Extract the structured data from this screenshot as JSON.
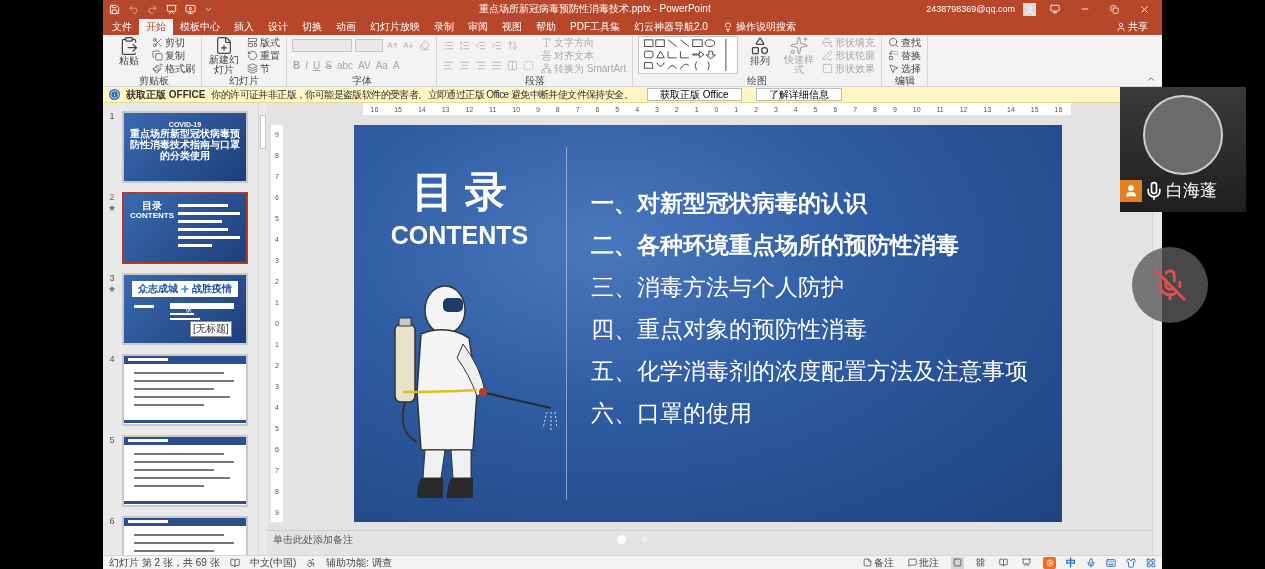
{
  "window": {
    "title": "重点场所新冠病毒预防性消毒技术.pptx  -  PowerPoint",
    "account": "2438798369@qq.com"
  },
  "tabs": [
    {
      "label": "文件",
      "selected": false
    },
    {
      "label": "开始",
      "selected": true
    },
    {
      "label": "模板中心",
      "selected": false
    },
    {
      "label": "插入",
      "selected": false
    },
    {
      "label": "设计",
      "selected": false
    },
    {
      "label": "切换",
      "selected": false
    },
    {
      "label": "动画",
      "selected": false
    },
    {
      "label": "幻灯片放映",
      "selected": false
    },
    {
      "label": "录制",
      "selected": false
    },
    {
      "label": "审阅",
      "selected": false
    },
    {
      "label": "视图",
      "selected": false
    },
    {
      "label": "帮助",
      "selected": false
    },
    {
      "label": "PDF工具集",
      "selected": false
    },
    {
      "label": "幻云神器导航2.0",
      "selected": false
    }
  ],
  "tell_me": "操作说明搜索",
  "share": "共享",
  "ribbon": [
    {
      "label": "剪贴板",
      "columns": [
        [
          {
            "kind": "large",
            "label": "粘贴",
            "disabled": false
          }
        ],
        [
          {
            "kind": "small",
            "label": "剪切",
            "disabled": false
          },
          {
            "kind": "small",
            "label": "复制",
            "disabled": false
          },
          {
            "kind": "small",
            "label": "格式刷",
            "disabled": false
          }
        ]
      ]
    },
    {
      "label": "幻灯片",
      "columns": [
        [
          {
            "kind": "large",
            "label": "新建幻灯片",
            "disabled": false
          }
        ],
        [
          {
            "kind": "small",
            "label": "版式",
            "disabled": false
          },
          {
            "kind": "small",
            "label": "重置",
            "disabled": false
          },
          {
            "kind": "small",
            "label": "节",
            "disabled": false
          }
        ]
      ]
    },
    {
      "label": "字体",
      "columns": [
        [
          {
            "kind": "toolrow",
            "tools": [
              {
                "kind": "field"
              },
              {
                "kind": "field"
              },
              {
                "kind": "icon"
              },
              {
                "kind": "icon"
              },
              {
                "kind": "icon"
              }
            ],
            "disabled": true
          },
          {
            "kind": "toolrow",
            "tools": [
              {
                "kind": "char",
                "label": "B"
              },
              {
                "kind": "char",
                "label": "I"
              },
              {
                "kind": "char",
                "label": "U"
              },
              {
                "kind": "char",
                "label": "S"
              },
              {
                "kind": "char",
                "label": "abc"
              },
              {
                "kind": "char",
                "label": "AV"
              },
              {
                "kind": "char",
                "label": "Aa"
              },
              {
                "kind": "char",
                "label": "A"
              }
            ],
            "disabled": true
          }
        ]
      ]
    },
    {
      "label": "段落",
      "columns": [
        [
          {
            "kind": "toolrow",
            "tools": [
              {
                "kind": "icon"
              },
              {
                "kind": "icon"
              },
              {
                "kind": "icon"
              },
              {
                "kind": "icon"
              },
              {
                "kind": "icon"
              }
            ],
            "disabled": true
          },
          {
            "kind": "toolrow",
            "tools": [
              {
                "kind": "icon"
              },
              {
                "kind": "icon"
              },
              {
                "kind": "icon"
              },
              {
                "kind": "icon"
              },
              {
                "kind": "icon"
              },
              {
                "kind": "icon"
              }
            ],
            "disabled": true
          }
        ],
        [
          {
            "kind": "small",
            "label": "文字方向",
            "disabled": true
          },
          {
            "kind": "small",
            "label": "对齐文本",
            "disabled": true
          },
          {
            "kind": "small",
            "label": "转换为 SmartArt",
            "disabled": true
          }
        ]
      ]
    },
    {
      "label": "绘图",
      "columns": [
        [
          {
            "kind": "gallery",
            "disabled": false
          }
        ],
        [
          {
            "kind": "large",
            "label": "排列",
            "disabled": false
          }
        ],
        [
          {
            "kind": "large",
            "label": "快速样式",
            "disabled": true
          }
        ],
        [
          {
            "kind": "small",
            "label": "形状填充",
            "disabled": true
          },
          {
            "kind": "small",
            "label": "形状轮廓",
            "disabled": true
          },
          {
            "kind": "small",
            "label": "形状效果",
            "disabled": true
          }
        ]
      ]
    },
    {
      "label": "编辑",
      "columns": [
        [
          {
            "kind": "small",
            "label": "查找",
            "disabled": false
          },
          {
            "kind": "small",
            "label": "替换",
            "disabled": false
          },
          {
            "kind": "small",
            "label": "选择",
            "disabled": false
          }
        ]
      ]
    }
  ],
  "notice": {
    "title": "获取正版 OFFICE",
    "message": "你的许可证并非正版，你可能是盗版软件的受害者。立即通过正版 Office 避免中断并使文件保持安全。",
    "buttons": [
      "获取正版 Office",
      "了解详细信息"
    ]
  },
  "ruler": [
    "16",
    "15",
    "14",
    "13",
    "12",
    "11",
    "10",
    "9",
    "8",
    "7",
    "6",
    "5",
    "4",
    "3",
    "2",
    "1",
    "0",
    "1",
    "2",
    "3",
    "4",
    "5",
    "6",
    "7",
    "8",
    "9",
    "10",
    "11",
    "12",
    "13",
    "14",
    "15",
    "16"
  ],
  "vertical_ruler": [
    "9",
    "8",
    "7",
    "6",
    "5",
    "4",
    "3",
    "2",
    "1",
    "0",
    "1",
    "2",
    "3",
    "4",
    "5",
    "6",
    "7",
    "8",
    "9"
  ],
  "thumbnails": [
    {
      "number": "1",
      "kind": "title",
      "selected": false,
      "animated": false,
      "texts": [
        "COVID-19",
        "重点场所新型冠状病毒预防性消毒技术指南与口罩的分类使用"
      ]
    },
    {
      "number": "2",
      "kind": "toc",
      "selected": true,
      "animated": true,
      "texts": [
        "目录",
        "CONTENTS"
      ]
    },
    {
      "number": "3",
      "kind": "section",
      "selected": false,
      "animated": true,
      "texts": [
        "众志成城",
        "战胜疫情",
        "[无标题]"
      ]
    },
    {
      "number": "4",
      "kind": "content",
      "selected": false,
      "animated": false
    },
    {
      "number": "5",
      "kind": "content",
      "selected": false,
      "animated": false
    },
    {
      "number": "6",
      "kind": "content",
      "selected": false,
      "animated": false
    }
  ],
  "slide": {
    "title": "目 录",
    "subtitle": "CONTENTS",
    "items": [
      {
        "text": "一、对新型冠状病毒的认识",
        "emphasized": true
      },
      {
        "text": "二、各种环境重点场所的预防性消毒",
        "emphasized": true
      },
      {
        "text": "三、消毒方法与个人防护",
        "emphasized": false
      },
      {
        "text": "四、重点对象的预防性消毒",
        "emphasized": false
      },
      {
        "text": "五、化学消毒剂的浓度配置方法及注意事项",
        "emphasized": false
      },
      {
        "text": "六、口罩的使用",
        "emphasized": false
      }
    ]
  },
  "notes": {
    "placeholder": "单击此处添加备注"
  },
  "pager": [
    {
      "selected": true
    },
    {
      "selected": false
    }
  ],
  "status_bar": {
    "slide_info": "幻灯片 第 2 张，共 69 张",
    "language": "中文(中国)",
    "accessibility": "辅助功能: 调查",
    "notes": "备注",
    "comments": "批注",
    "ime": "中"
  },
  "video": {
    "name": "白海蓬",
    "muted": true
  }
}
